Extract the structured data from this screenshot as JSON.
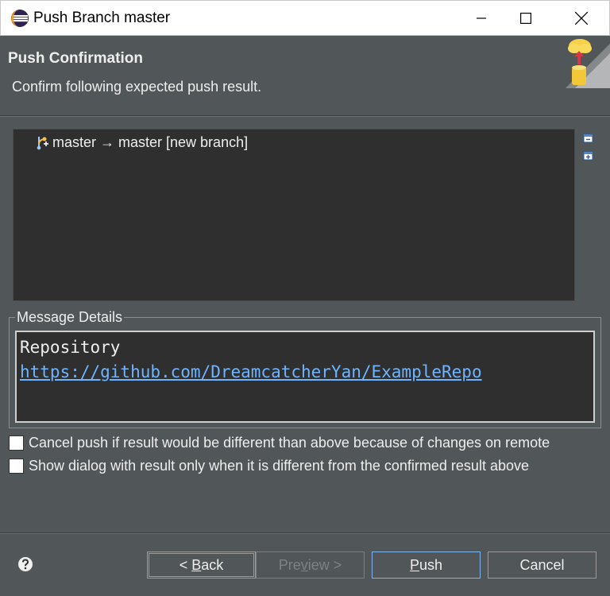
{
  "window": {
    "title": "Push Branch master"
  },
  "header": {
    "title": "Push Confirmation",
    "description": "Confirm following expected push result."
  },
  "tree": {
    "items": [
      {
        "label": "master → master [new branch]"
      }
    ]
  },
  "message_details": {
    "legend": "Message Details",
    "repository_label": "Repository",
    "repository_url": "https://github.com/DreamcatcherYan/ExampleRepo"
  },
  "options": {
    "cancel_push_label": "Cancel push if result would be different than above because of changes on remote",
    "show_dialog_label": "Show dialog with result only when it is different from the confirmed result above"
  },
  "buttons": {
    "back_prefix": "< ",
    "back_mnemonic": "B",
    "back_rest": "ack",
    "preview_prefix": "Pre",
    "preview_mnemonic": "v",
    "preview_rest": "iew >",
    "push_mnemonic": "P",
    "push_rest": "ush",
    "cancel": "Cancel"
  },
  "colors": {
    "background": "#515658",
    "tree_background": "#2f2f2f",
    "link": "#6fb4ff",
    "primary_border": "#7eb4ea"
  }
}
